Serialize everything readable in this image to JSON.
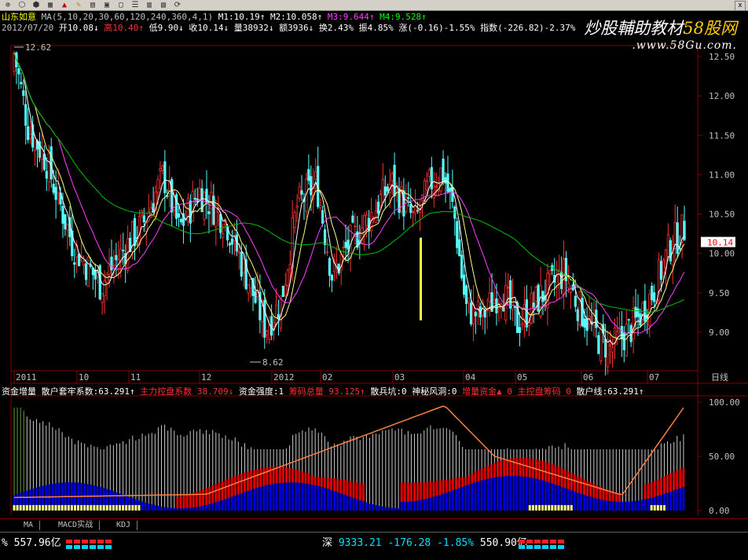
{
  "watermark": {
    "prefix": "炒股輔助教材",
    "brand": "58股网",
    "url": ".www.58Gu.com."
  },
  "toolbar": {
    "close_label": "x"
  },
  "header": {
    "stock_name": "山东如意",
    "ma_params": "MA(5,10,20,30,60,120,240,360,4,1)",
    "m1": "M1:10.19↑",
    "m2": "M2:10.058↑",
    "m3": "M3:9.644↑",
    "m4": "M4:9.528↑"
  },
  "info": {
    "date": "2012/07/20",
    "open": "开10.08↓",
    "high": "高10.40↑",
    "low": "低9.90↓",
    "close": "收10.14↓",
    "volume": "量38932↓",
    "amount": "额3936↓",
    "turnover": "换2.43%",
    "amplitude": "振4.85%",
    "change": "涨(-0.16)-1.55%",
    "index": "指数(-226.82)-2.37%"
  },
  "price_panel": {
    "y_ticks": [
      "12.50",
      "12.00",
      "11.50",
      "11.00",
      "10.50",
      "10.00",
      "9.50",
      "9.00"
    ],
    "high_label": "12.62",
    "low_label": "8.62",
    "current_label": "10.14",
    "x_labels": [
      "2011",
      "10",
      "11",
      "12",
      "2012",
      "02",
      "03",
      "04",
      "05",
      "06",
      "07"
    ],
    "period": "日线"
  },
  "indicator_panel": {
    "labels": [
      {
        "text": "资金增量",
        "color": "#ffffff"
      },
      {
        "text": "散户套牢系数:63.291↑",
        "color": "#ffffff"
      },
      {
        "text": "主力控盘系数 38.709↓",
        "color": "#ff3030"
      },
      {
        "text": "资金强度:1",
        "color": "#ffffff"
      },
      {
        "text": "筹码总量 93.125↑",
        "color": "#ff3030"
      },
      {
        "text": "散兵坑:0",
        "color": "#ffffff"
      },
      {
        "text": "神秘风洞:0",
        "color": "#ffffff"
      },
      {
        "text": "增量资金▲ 0",
        "color": "#ff3030"
      },
      {
        "text": "主控盘筹码 0",
        "color": "#ff3030"
      },
      {
        "text": "散户线:63.291↑",
        "color": "#ffffff"
      }
    ],
    "y_ticks": [
      "100.00",
      "50.00",
      "0.00"
    ]
  },
  "tabs": [
    "MA",
    "MACD实战",
    "KDJ"
  ],
  "status": {
    "left_text": "% 557.96亿",
    "market": "深",
    "index_value": "9333.21",
    "index_change": "-176.28",
    "index_pct": "-1.85%",
    "amount": "550.90亿"
  }
}
